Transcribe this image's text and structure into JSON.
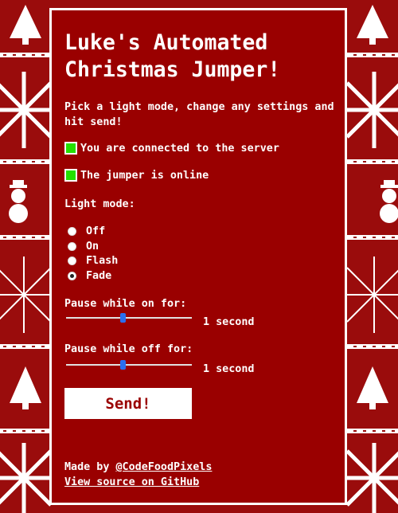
{
  "title": "Luke's Automated Christmas Jumper!",
  "intro": "Pick a light mode, change any settings and hit send!",
  "status": {
    "connection": "You are connected to the server",
    "jumper": "The jumper is online"
  },
  "light_mode": {
    "label": "Light mode:",
    "options": [
      "Off",
      "On",
      "Flash",
      "Fade"
    ],
    "selected": "Fade"
  },
  "pause_on": {
    "label": "Pause while on for:",
    "value_text": "1 second",
    "level": 0.45
  },
  "pause_off": {
    "label": "Pause while off for:",
    "value_text": "1 second",
    "level": 0.45
  },
  "send_label": "Send!",
  "footer": {
    "made_by_prefix": "Made by ",
    "made_by_link": "@CodeFoodPixels",
    "source_link": "View source on GitHub"
  },
  "colors": {
    "background": "#9a0c0c",
    "accent_green": "#25e000",
    "slider_thumb": "#2a6ff0"
  }
}
